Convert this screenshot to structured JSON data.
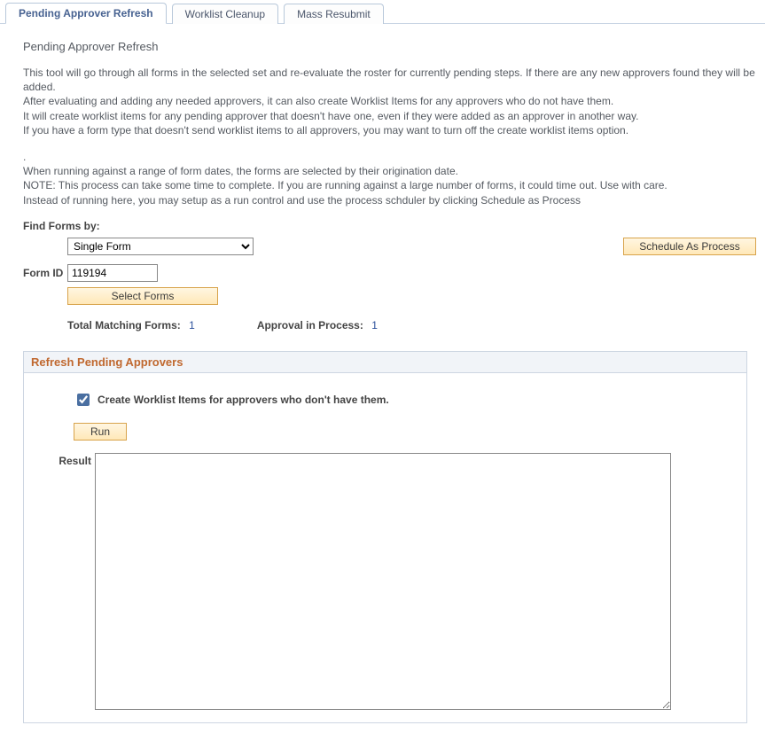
{
  "tabs": [
    {
      "label": "Pending Approver Refresh",
      "active": true
    },
    {
      "label": "Worklist Cleanup",
      "active": false
    },
    {
      "label": "Mass Resubmit",
      "active": false
    }
  ],
  "page": {
    "title": "Pending Approver Refresh",
    "para1": "This tool will go through all forms in the selected set and re-evaluate the roster for currently pending steps. If there are any new approvers found they will be added.",
    "para2": "After evaluating and adding any needed approvers, it can also create Worklist Items for any approvers who do not have them.",
    "para3": "It will create worklist items for any pending approver that doesn't have one, even if they were added as an approver in another way.",
    "para4": "If you have a form type that doesn't send worklist items to all approvers, you may want to turn off the create worklist items option.",
    "para5": "When running against a range of form dates, the forms are selected by their origination date.",
    "para6": "NOTE: This process can take some time to complete. If you are running against a large number of forms, it could time out. Use with care.",
    "para7": "Instead of running here, you may setup as a run control and use the process schduler by clicking Schedule as Process"
  },
  "find": {
    "label": "Find Forms by:",
    "selected": "Single Form",
    "schedule_btn": "Schedule As Process"
  },
  "formid": {
    "label": "Form ID",
    "value": "119194",
    "select_btn": "Select Forms"
  },
  "counts": {
    "total_label": "Total Matching Forms:",
    "total_value": "1",
    "approval_label": "Approval in Process:",
    "approval_value": "1"
  },
  "group": {
    "title": "Refresh Pending Approvers",
    "checkbox_label": "Create Worklist Items for approvers who don't have them.",
    "checkbox_checked": true,
    "run_btn": "Run",
    "result_label": "Result",
    "result_value": ""
  }
}
